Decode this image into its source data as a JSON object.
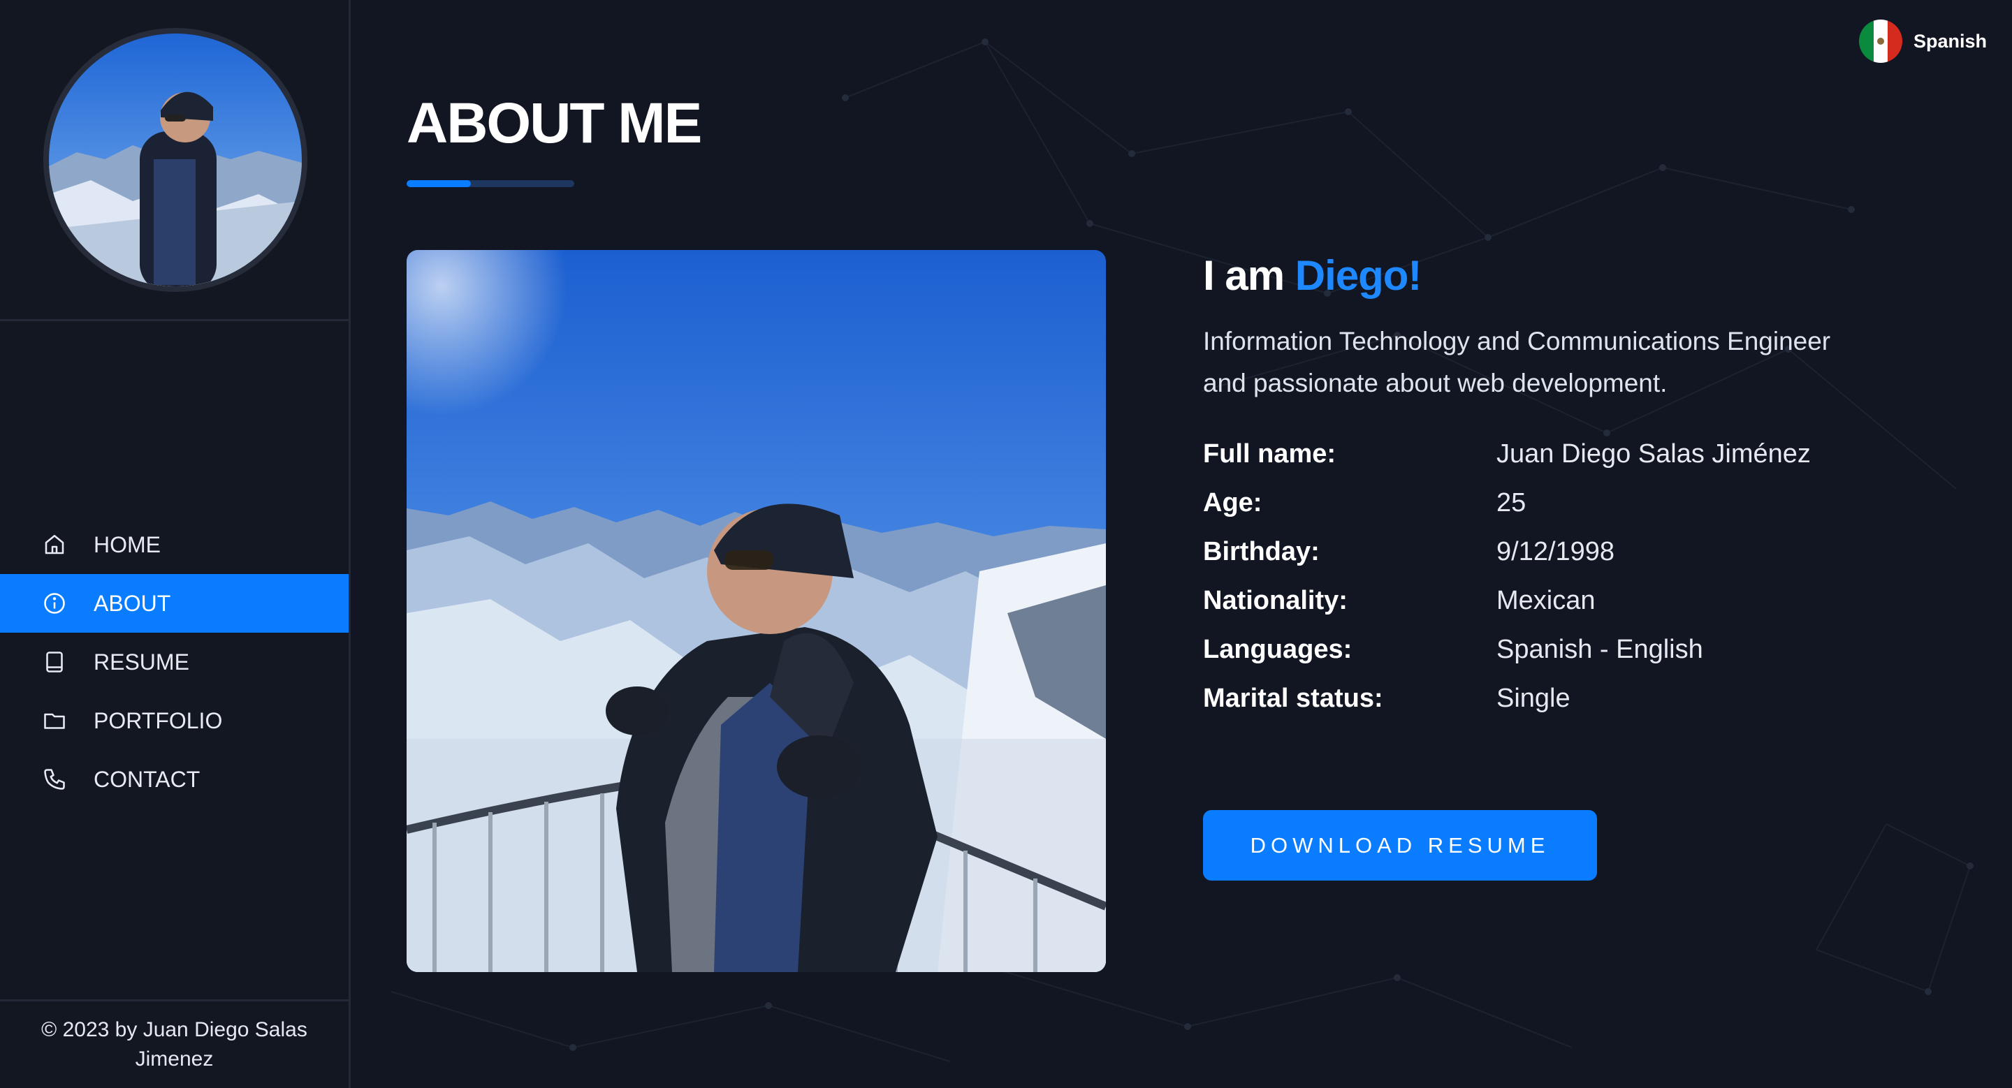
{
  "language": {
    "label": "Spanish",
    "flag_colors": [
      "#0a8a3c",
      "#ffffff",
      "#d52b1e"
    ]
  },
  "sidebar": {
    "nav": [
      {
        "label": "HOME",
        "icon": "home-icon",
        "active": false
      },
      {
        "label": "ABOUT",
        "icon": "info-icon",
        "active": true
      },
      {
        "label": "RESUME",
        "icon": "book-icon",
        "active": false
      },
      {
        "label": "PORTFOLIO",
        "icon": "folder-icon",
        "active": false
      },
      {
        "label": "CONTACT",
        "icon": "phone-icon",
        "active": false
      }
    ],
    "footer": "© 2023 by Juan Diego Salas Jimenez"
  },
  "page": {
    "title": "ABOUT ME",
    "greeting_prefix": "I am ",
    "greeting_name": "Diego!",
    "intro": "Information Technology and Communications Engineer and passionate about web development.",
    "facts": [
      {
        "label": "Full name:",
        "value": "Juan Diego Salas Jiménez"
      },
      {
        "label": "Age:",
        "value": "25"
      },
      {
        "label": "Birthday:",
        "value": "9/12/1998"
      },
      {
        "label": "Nationality:",
        "value": "Mexican"
      },
      {
        "label": "Languages:",
        "value": "Spanish - English"
      },
      {
        "label": "Marital status:",
        "value": "Single"
      }
    ],
    "download_label": "DOWNLOAD RESUME"
  },
  "colors": {
    "accent": "#0a7cff",
    "background": "#121622"
  }
}
